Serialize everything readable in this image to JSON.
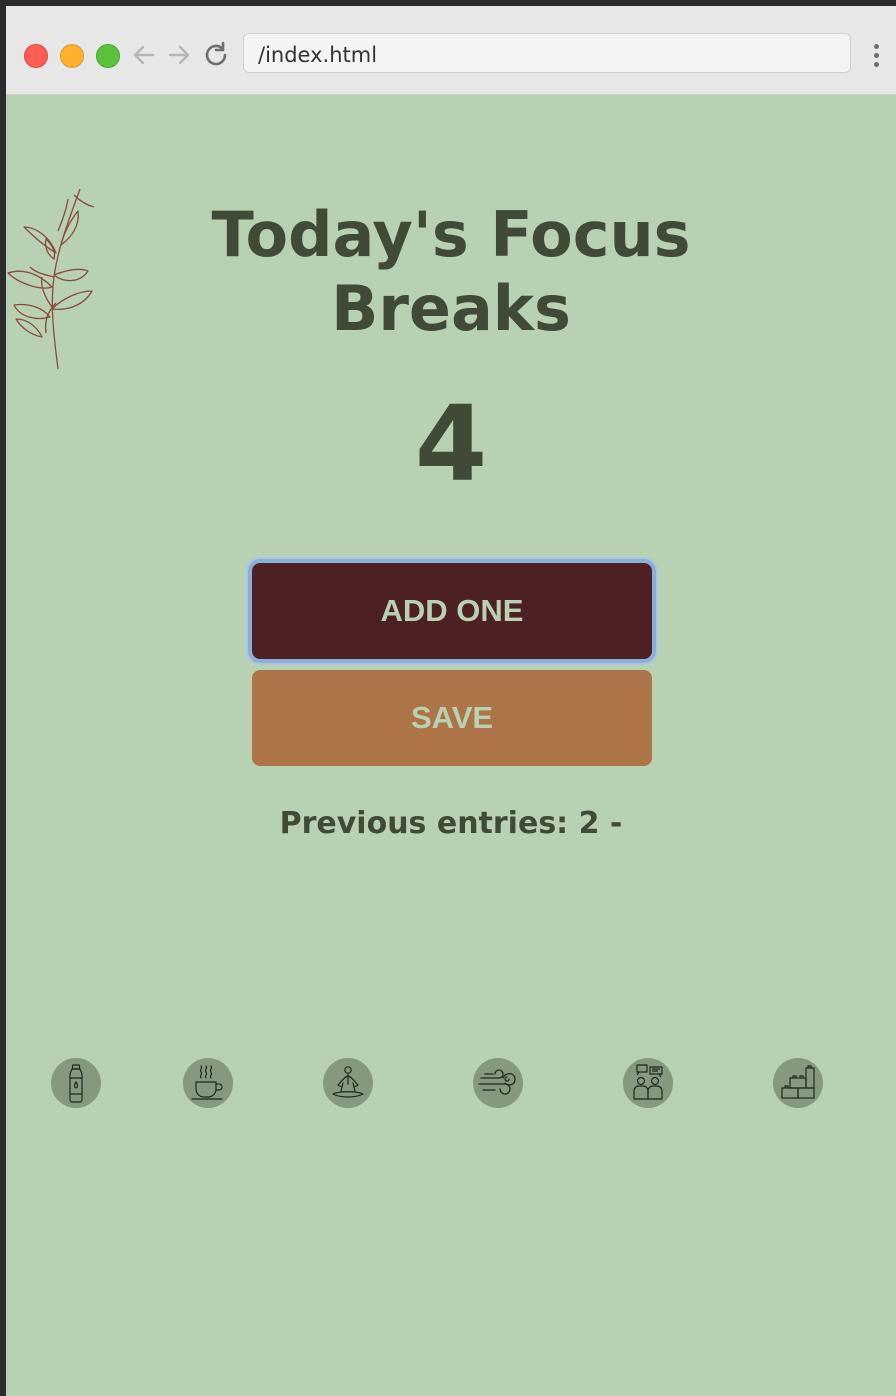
{
  "browser": {
    "url": "/index.html"
  },
  "main": {
    "title": "Today's Focus Breaks",
    "count": "4",
    "add_button_label": "ADD ONE",
    "save_button_label": "SAVE",
    "previous_entries": "Previous entries: 2 -"
  },
  "colors": {
    "background": "#b8d1b3",
    "text": "#404a36",
    "add_button": "#4d2124",
    "save_button": "#ad7448",
    "icon_circle": "#85997f",
    "branch": "#8a4a40"
  },
  "break_icons": [
    "water-bottle-icon",
    "coffee-cup-icon",
    "meditation-icon",
    "wind-icon",
    "conversation-icon",
    "blocks-icon"
  ]
}
